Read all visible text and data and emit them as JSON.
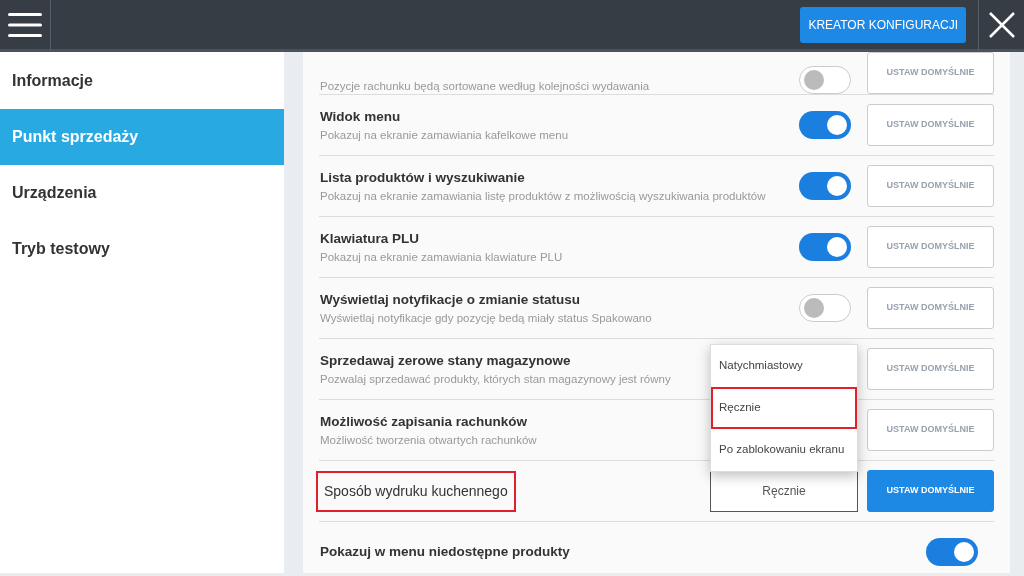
{
  "header": {
    "wizard_button": "KREATOR KONFIGURACJI"
  },
  "sidebar": {
    "items": [
      {
        "label": "Informacje",
        "selected": false
      },
      {
        "label": "Punkt sprzedaży",
        "selected": true
      },
      {
        "label": "Urządzenia",
        "selected": false
      },
      {
        "label": "Tryb testowy",
        "selected": false
      }
    ]
  },
  "settings": [
    {
      "kind": "toggle",
      "description": "Pozycje rachunku będą sortowane według kolejności wydawania",
      "on": false,
      "reset_button": "USTAW DOMYŚLNIE",
      "reset_enabled": false
    },
    {
      "kind": "toggle",
      "title": "Widok menu",
      "description": "Pokazuj na ekranie zamawiania kafelkowe menu",
      "on": true,
      "reset_button": "USTAW DOMYŚLNIE",
      "reset_enabled": false
    },
    {
      "kind": "toggle",
      "title": "Lista produktów i wyszukiwanie",
      "description": "Pokazuj na ekranie zamawiania listę produktów z możliwością wyszukiwania produktów",
      "on": true,
      "reset_button": "USTAW DOMYŚLNIE",
      "reset_enabled": false
    },
    {
      "kind": "toggle",
      "title": "Klawiatura PLU",
      "description": "Pokazuj na ekranie zamawiania klawiature PLU",
      "on": true,
      "reset_button": "USTAW DOMYŚLNIE",
      "reset_enabled": false
    },
    {
      "kind": "toggle",
      "title": "Wyświetlaj notyfikacje o zmianie statusu",
      "description": "Wyświetlaj notyfikacje gdy pozycję bedą miały status Spakowano",
      "on": false,
      "reset_button": "USTAW DOMYŚLNIE",
      "reset_enabled": false
    },
    {
      "kind": "toggle",
      "title": "Sprzedawaj zerowe stany magazynowe",
      "description": "Pozwalaj sprzedawać produkty, których stan magazynowy jest równy",
      "reset_button": "USTAW DOMYŚLNIE",
      "reset_enabled": false
    },
    {
      "kind": "toggle",
      "title": "Możliwość zapisania rachunków",
      "description": "Możliwość tworzenia otwartych rachunków",
      "reset_button": "USTAW DOMYŚLNIE",
      "reset_enabled": false
    },
    {
      "kind": "select",
      "title": "Sposób wydruku kuchennego",
      "highlighted": true,
      "value": "Ręcznie",
      "expanded": true,
      "options": [
        {
          "label": "Natychmiastowy",
          "highlighted": false
        },
        {
          "label": "Ręcznie",
          "highlighted": true
        },
        {
          "label": "Po zablokowaniu ekranu",
          "highlighted": false
        }
      ],
      "reset_button": "USTAW DOMYŚLNIE",
      "reset_enabled": true
    },
    {
      "kind": "toggle",
      "title": "Pokazuj w menu niedostępne produkty",
      "on": true
    }
  ]
}
